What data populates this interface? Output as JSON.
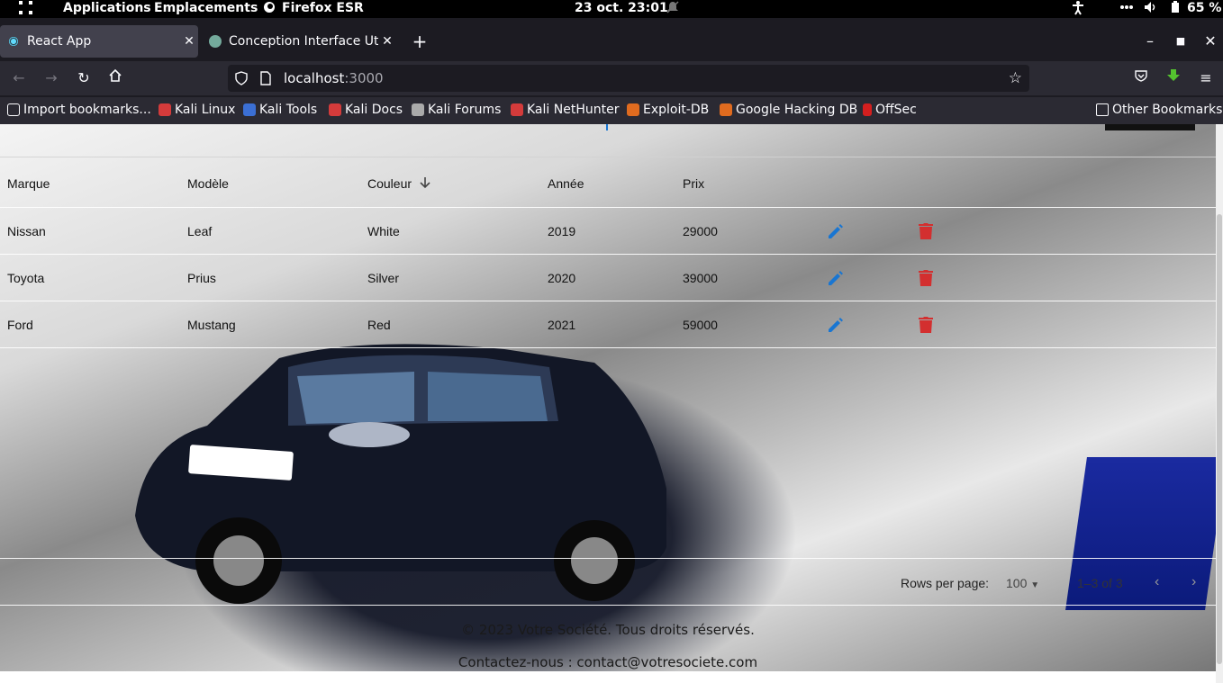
{
  "system_bar": {
    "applications": "Applications",
    "places": "Emplacements",
    "browser": "Firefox ESR",
    "datetime": "23 oct.  23:01",
    "battery": "65 %"
  },
  "tabs": [
    {
      "title": "React App",
      "active": true
    },
    {
      "title": "Conception Interface Utili",
      "active": false
    }
  ],
  "address_bar": {
    "host": "localhost",
    "port": ":3000"
  },
  "bookmarks": [
    {
      "label": "Import bookmarks..."
    },
    {
      "label": "Kali Linux"
    },
    {
      "label": "Kali Tools"
    },
    {
      "label": "Kali Docs"
    },
    {
      "label": "Kali Forums"
    },
    {
      "label": "Kali NetHunter"
    },
    {
      "label": "Exploit-DB"
    },
    {
      "label": "Google Hacking DB"
    },
    {
      "label": "OffSec"
    }
  ],
  "other_bookmarks": "Other Bookmarks",
  "table": {
    "columns": [
      "Marque",
      "Modèle",
      "Couleur",
      "Année",
      "Prix"
    ],
    "rows": [
      [
        "Nissan",
        "Leaf",
        "White",
        "2019",
        "29000"
      ],
      [
        "Toyota",
        "Prius",
        "Silver",
        "2020",
        "39000"
      ],
      [
        "Ford",
        "Mustang",
        "Red",
        "2021",
        "59000"
      ]
    ]
  },
  "pagination": {
    "rows_per_page_label": "Rows per page:",
    "rows_per_page_value": "100",
    "range": "1–3 of 3"
  },
  "footer": {
    "copyright": "© 2023 Votre Société. Tous droits réservés.",
    "contact": "Contactez-nous : contact@votresociete.com"
  },
  "colors": {
    "accent_blue": "#1976d2",
    "delete_red": "#d32f2f"
  }
}
